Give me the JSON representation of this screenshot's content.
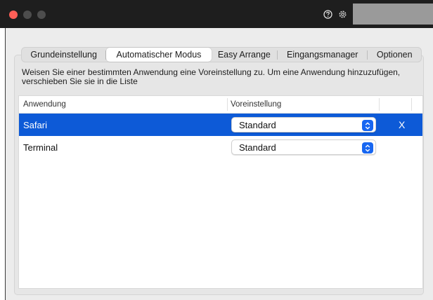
{
  "titlebar": {
    "help_icon": "question-circle-icon",
    "settings_icon": "gear-icon"
  },
  "tabs": [
    {
      "label": "Grundeinstellung",
      "active": false
    },
    {
      "label": "Automatischer Modus",
      "active": true
    },
    {
      "label": "Easy Arrange",
      "active": false
    },
    {
      "label": "Eingangsmanager",
      "active": false
    },
    {
      "label": "Optionen",
      "active": false
    }
  ],
  "description": "Weisen Sie einer bestimmten Anwendung eine Voreinstellung zu.  Um eine Anwendung hinzuzufügen, verschieben Sie sie in die Liste",
  "table": {
    "columns": [
      "Anwendung",
      "Voreinstellung"
    ],
    "rows": [
      {
        "app": "Safari",
        "preset": "Standard",
        "selected": true,
        "remove": "X"
      },
      {
        "app": "Terminal",
        "preset": "Standard",
        "selected": false
      }
    ]
  },
  "colors": {
    "selection": "#0d5ad7",
    "titlebar": "#1e1e1e",
    "close": "#ff5f57"
  }
}
